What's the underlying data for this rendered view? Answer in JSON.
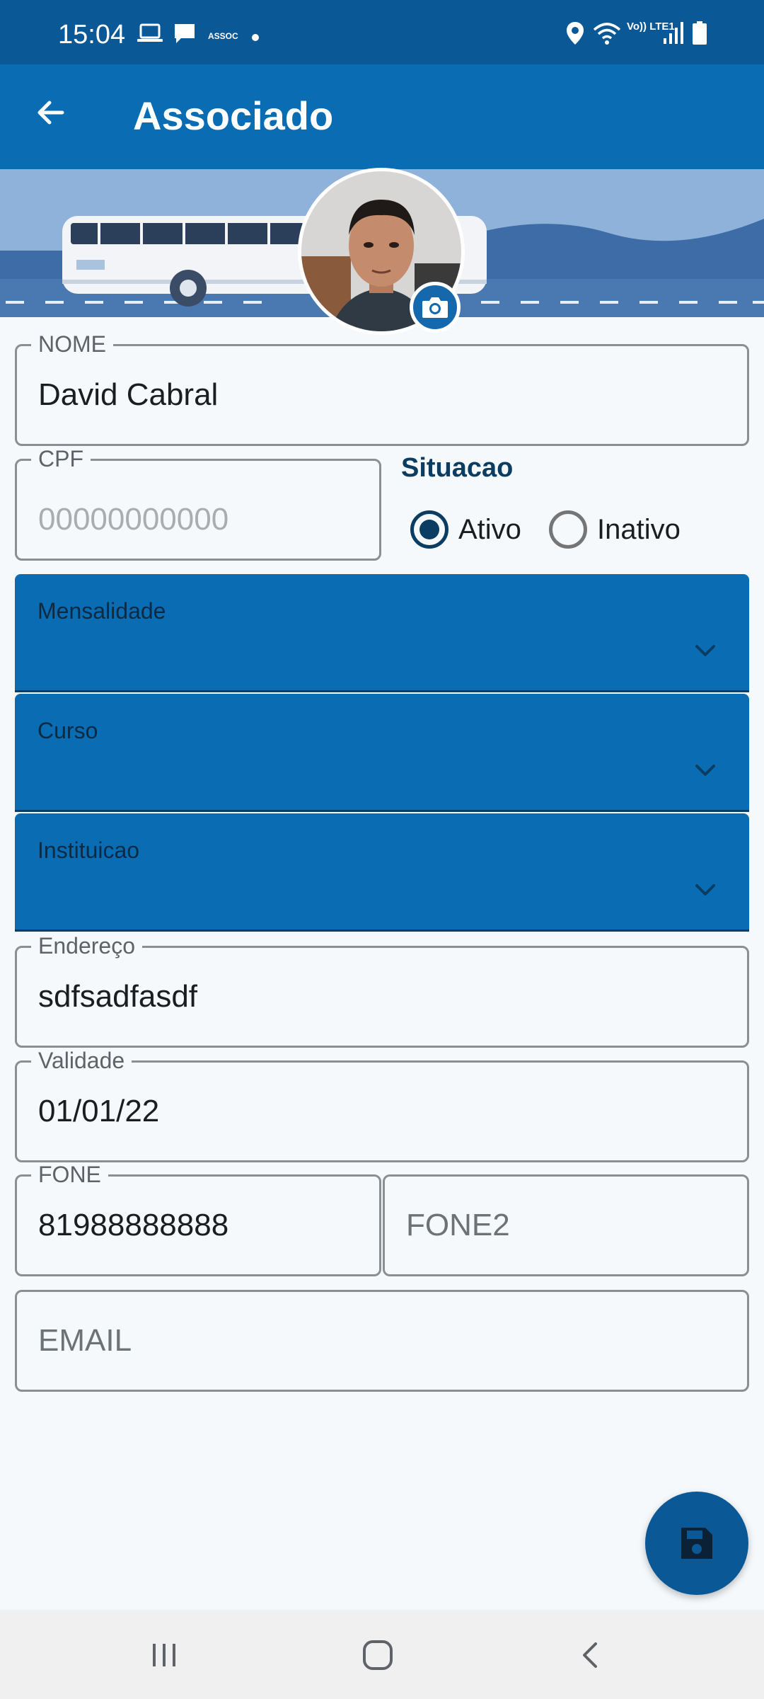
{
  "status_bar": {
    "time": "15:04",
    "notif_app": "ASSOC",
    "network": "Vo)) LTE1",
    "icons": [
      "laptop-icon",
      "chat-icon",
      "location-icon",
      "wifi-icon",
      "signal-icon",
      "battery-icon"
    ]
  },
  "app_bar": {
    "title": "Associado",
    "back_icon": "arrow-left-icon"
  },
  "profile": {
    "camera_icon": "camera-icon"
  },
  "form": {
    "nome": {
      "label": "NOME",
      "value": "David Cabral"
    },
    "cpf": {
      "label": "CPF",
      "placeholder": "00000000000"
    },
    "situacao": {
      "title": "Situacao",
      "options": [
        {
          "label": "Ativo",
          "checked": true
        },
        {
          "label": "Inativo",
          "checked": false
        }
      ]
    },
    "mensalidade": {
      "label": "Mensalidade"
    },
    "curso": {
      "label": "Curso"
    },
    "instituicao": {
      "label": "Instituicao"
    },
    "endereco": {
      "label": "Endereço",
      "value": "sdfsadfasdf"
    },
    "validade": {
      "label": "Validade",
      "value": "01/01/22"
    },
    "fone": {
      "label": "FONE",
      "value": "81988888888"
    },
    "fone2": {
      "placeholder": "FONE2"
    },
    "email": {
      "placeholder": "EMAIL"
    }
  },
  "fab": {
    "icon": "save-icon"
  },
  "nav_bar": {
    "icons": [
      "recents-icon",
      "home-icon",
      "back-icon"
    ]
  },
  "colors": {
    "status_bar": "#0b5896",
    "app_bar": "#0a6db3",
    "dropdown": "#0a6db3",
    "accent_dark": "#0b3d63",
    "background": "#f5f9fc"
  }
}
